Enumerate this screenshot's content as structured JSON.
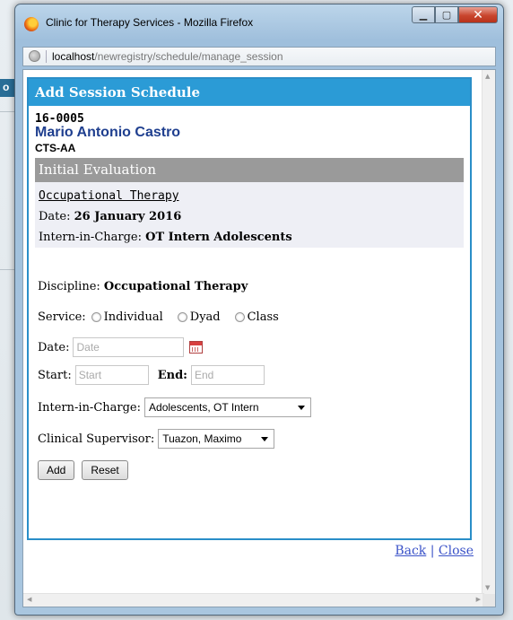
{
  "window": {
    "title": "Clinic for Therapy Services - Mozilla Firefox",
    "url_host": "localhost",
    "url_path": "/newregistry/schedule/manage_session"
  },
  "background": {
    "strip_text": "o"
  },
  "dialog": {
    "title": "Add Session Schedule",
    "case_id": "16-0005",
    "patient_name": "Mario Antonio Castro",
    "patient_code": "CTS-AA",
    "evaluation": {
      "header": "Initial Evaluation",
      "discipline": "Occupational Therapy",
      "date_label": "Date: ",
      "date_value": "26 January 2016",
      "intern_label": "Intern-in-Charge: ",
      "intern_value": "OT Intern Adolescents"
    },
    "form": {
      "discipline_label": "Discipline: ",
      "discipline_value": "Occupational Therapy",
      "service_label": "Service:",
      "service_options": [
        "Individual",
        "Dyad",
        "Class"
      ],
      "date_label": "Date:",
      "date_placeholder": "Date",
      "start_label": "Start:",
      "start_placeholder": "Start",
      "end_label": "End:",
      "end_placeholder": "End",
      "intern_label": "Intern-in-Charge:",
      "intern_selected": "Adolescents, OT Intern",
      "supervisor_label": "Clinical Supervisor:",
      "supervisor_selected": "Tuazon, Maximo",
      "add_button": "Add",
      "reset_button": "Reset"
    },
    "links": {
      "back": "Back",
      "separator": "|",
      "close": "Close"
    }
  },
  "icons": [
    "firefox-icon",
    "globe-icon",
    "calendar-icon",
    "dropdown-arrow-icon"
  ]
}
